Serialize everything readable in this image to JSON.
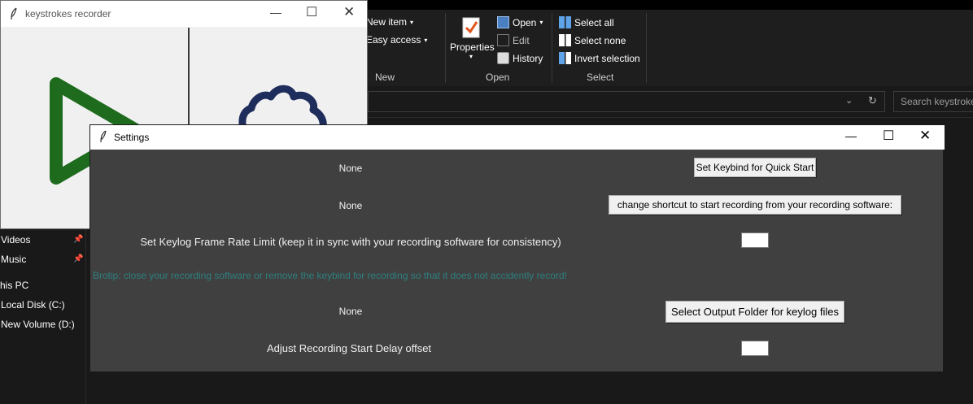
{
  "explorer": {
    "ribbon": {
      "new_item": "New item",
      "easy_access": "Easy access",
      "new_group": "New",
      "properties": "Properties",
      "open": "Open",
      "edit": "Edit",
      "history": "History",
      "open_group": "Open",
      "select_all": "Select all",
      "select_none": "Select none",
      "invert_selection": "Invert selection",
      "select_group": "Select"
    },
    "search_placeholder": "Search keystrokes",
    "nav": {
      "videos": "Videos",
      "music": "Music",
      "this_pc": "his PC",
      "local_disk": "Local Disk (C:)",
      "new_volume": "New Volume (D:)"
    }
  },
  "recorder": {
    "title": "keystrokes recorder"
  },
  "settings": {
    "title": "Settings",
    "quick_start_value": "None",
    "quick_start_button": "Set Keybind for Quick Start",
    "shortcut_value": "None",
    "shortcut_button": "change shortcut to start recording from your recording software:",
    "frame_rate_label": "Set Keylog Frame Rate Limit (keep it in sync with your recording software for consistency)",
    "frame_rate_value": "",
    "tip": "Brotip: close your recording software or remove the keybind for recording so that it does not accidently record!",
    "output_value": "None",
    "output_button": "Select Output Folder for keylog files",
    "delay_label": "Adjust Recording Start Delay offset",
    "delay_value": ""
  },
  "colors": {
    "play_icon": "#1e6b1e",
    "gear_icon": "#1f2d5c",
    "tip_text": "#2e7f7f",
    "settings_bg": "#404040"
  }
}
